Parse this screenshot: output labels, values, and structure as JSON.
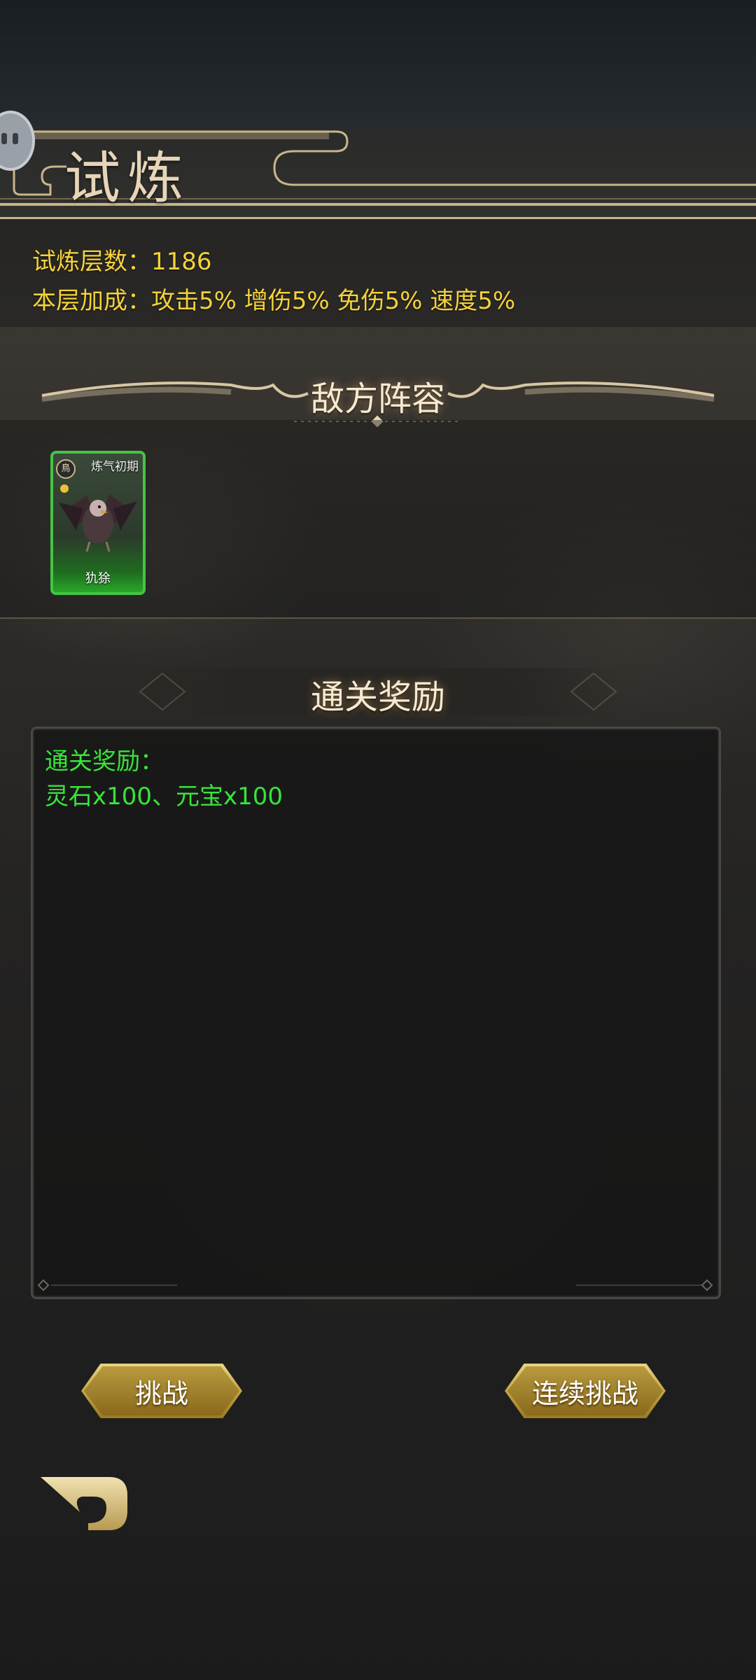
{
  "page": {
    "title": "试炼"
  },
  "info": {
    "floor_label": "试炼层数：",
    "floor_value": "1186",
    "bonus_label": "本层加成：",
    "bonus_value": "攻击5% 增伤5% 免伤5% 速度5%"
  },
  "enemy": {
    "section_title": "敌方阵容",
    "cards": [
      {
        "race": "鳥",
        "realm": "炼气初期",
        "name": "犰狳"
      }
    ]
  },
  "rewards": {
    "section_title": "通关奖励",
    "label": "通关奖励：",
    "items": "灵石x100、元宝x100"
  },
  "buttons": {
    "challenge": "挑战",
    "continuous_challenge": "连续挑战"
  },
  "colors": {
    "info_text": "#f5d23a",
    "reward_text": "#36e53a",
    "card_border": "#45c445",
    "gold": "#c9b48a"
  },
  "icons": {
    "back": "back-arrow-icon",
    "avatar": "avatar-icon"
  }
}
